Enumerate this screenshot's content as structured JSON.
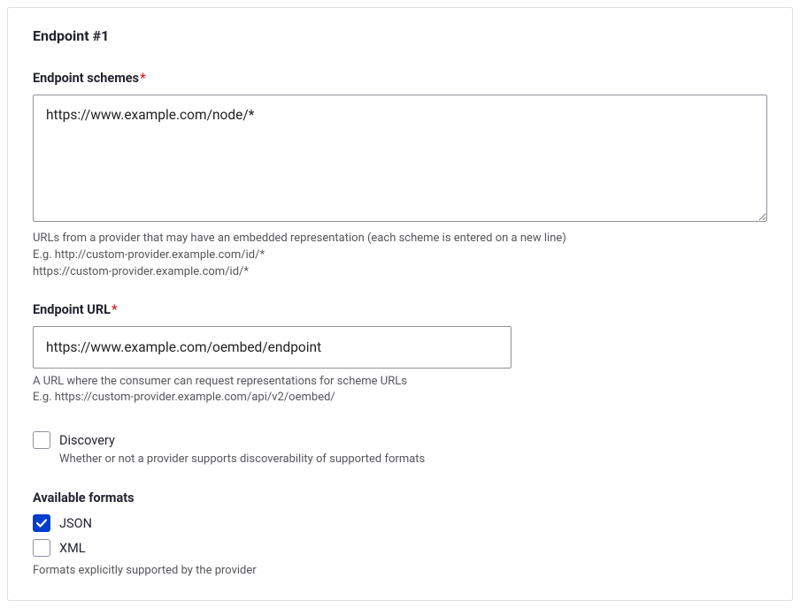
{
  "title": "Endpoint #1",
  "schemes": {
    "label": "Endpoint schemes",
    "required_mark": "*",
    "value": "https://www.example.com/node/*",
    "description_line1": "URLs from a provider that may have an embedded representation (each scheme is entered on a new line)",
    "description_line2": "E.g. http://custom-provider.example.com/id/*",
    "description_line3": "https://custom-provider.example.com/id/*"
  },
  "url": {
    "label": "Endpoint URL",
    "required_mark": "*",
    "value": "https://www.example.com/oembed/endpoint",
    "description_line1": "A URL where the consumer can request representations for scheme URLs",
    "description_line2": "E.g. https://custom-provider.example.com/api/v2/oembed/"
  },
  "discovery": {
    "label": "Discovery",
    "checked": false,
    "description": "Whether or not a provider supports discoverability of supported formats"
  },
  "formats": {
    "title": "Available formats",
    "options": {
      "json": {
        "label": "JSON",
        "checked": true
      },
      "xml": {
        "label": "XML",
        "checked": false
      }
    },
    "description": "Formats explicitly supported by the provider"
  }
}
